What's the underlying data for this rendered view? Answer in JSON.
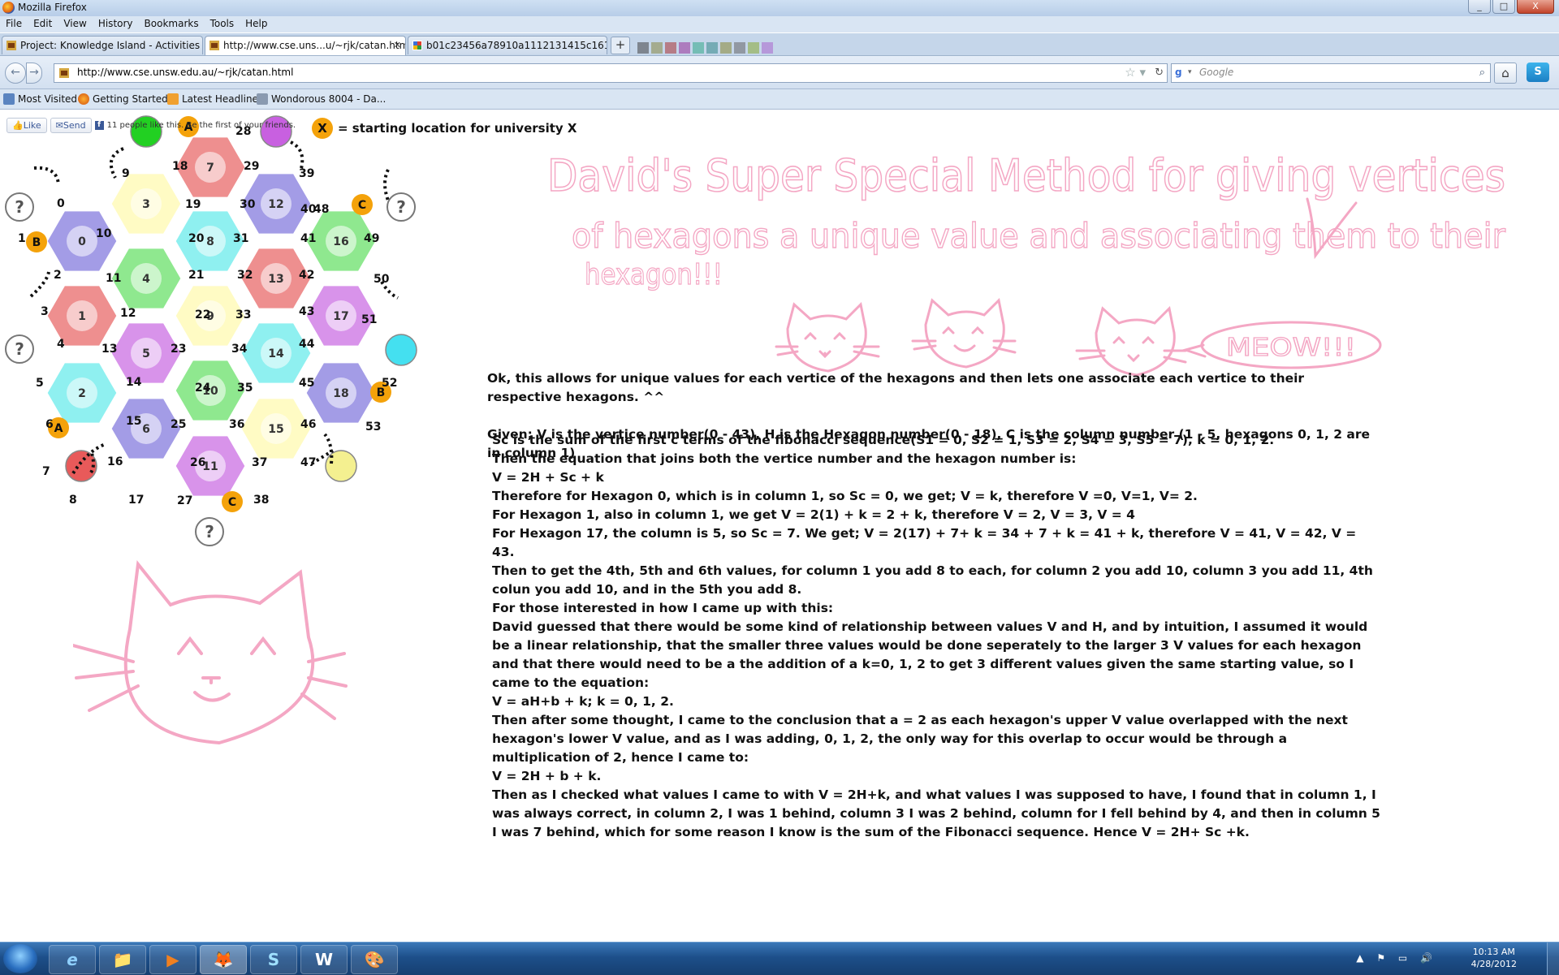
{
  "window": {
    "title": "Mozilla Firefox",
    "controls": [
      "_",
      "□",
      "X"
    ]
  },
  "menu": [
    "File",
    "Edit",
    "View",
    "History",
    "Bookmarks",
    "Tools",
    "Help"
  ],
  "tabs": [
    {
      "label": "Project: Knowledge Island - Activities ...",
      "active": false
    },
    {
      "label": "http://www.cse.uns...u/~rjk/catan.html",
      "active": true
    },
    {
      "label": "b01c23456a78910a1112131415c161...",
      "active": false
    }
  ],
  "newtab": "+",
  "nav": {
    "back": "←",
    "forward": "→",
    "url": "http://www.cse.unsw.edu.au/~rjk/catan.html",
    "search_placeholder": "Google",
    "search_engine": "g",
    "home": "⌂",
    "skype": "S"
  },
  "bookmarks": [
    "Most Visited",
    "Getting Started",
    "Latest Headlines",
    "Wondorous 8004 - Da..."
  ],
  "facebook": {
    "like": "Like",
    "send": "Send",
    "text": "11 people like this. Be the first of your friends."
  },
  "legend": {
    "badge": "X",
    "text": "= starting location for university X"
  },
  "board": {
    "hexes": [
      "0",
      "1",
      "2",
      "3",
      "4",
      "5",
      "6",
      "7",
      "8",
      "9",
      "10",
      "11",
      "12",
      "13",
      "14",
      "15",
      "16",
      "17",
      "18"
    ],
    "ports": [
      "?",
      "?",
      "?",
      "?"
    ],
    "markers": [
      "A",
      "B",
      "C",
      "A",
      "B",
      "C"
    ],
    "vertex_labels": [
      "0",
      "1",
      "2",
      "3",
      "4",
      "5",
      "6",
      "7",
      "8",
      "9",
      "10",
      "11",
      "12",
      "13",
      "14",
      "15",
      "16",
      "17",
      "18",
      "19",
      "20",
      "21",
      "22",
      "23",
      "24",
      "25",
      "26",
      "27",
      "28",
      "29",
      "30",
      "31",
      "32",
      "33",
      "34",
      "35",
      "36",
      "37",
      "38",
      "39",
      "40",
      "41",
      "42",
      "43",
      "44",
      "45",
      "46",
      "47",
      "48",
      "49",
      "50",
      "51",
      "52",
      "53"
    ]
  },
  "handwriting": {
    "title_line1": "David's Super Special Method for giving vertices",
    "title_line2": "of hexagons a unique value and associating them to their",
    "title_line3": "hexagon!!!",
    "meow": "MEOW!!!"
  },
  "content": {
    "intro": "Ok, this allows for unique values for each vertice of the hexagons and then lets one associate each vertice to their respective hexagons. ^^",
    "given": "Given; V is the vertice number(0 - 43), H is the Hexagon number(0 - 18), C is the column number (1 - 5, hexagons 0, 1, 2 are in column 1)",
    "lines": [
      "Sc is the sum of the first c terms of the fibonacci sequence(S1 = 0, S2 = 1, S3 = 2, S4 = 3, S5 = 7),  k = 0, 1, 2.",
      "Then the equation that joins both the vertice number and the hexagon number is:",
      "V = 2H + Sc + k",
      "Therefore for Hexagon 0, which is in column 1, so Sc = 0, we get; V = k, therefore V =0, V=1, V= 2.",
      "For Hexagon 1, also in column 1, we get V = 2(1) + k = 2 + k, therefore V = 2, V = 3, V = 4",
      "For Hexagon 17, the column is 5, so Sc = 7. We get; V = 2(17) + 7+ k = 34 + 7 + k = 41 + k, therefore V = 41, V = 42, V = 43.",
      "Then to get the 4th, 5th and 6th values, for column 1 you add 8 to each, for column 2 you add 10, column 3 you add 11, 4th colun you add 10, and in the 5th you add 8.",
      "For those interested in how I came up with this:",
      "David guessed that there would be some kind of relationship between values V and H, and by intuition, I assumed it would be a linear relationship, that the smaller three values would be done seperately to the larger 3 V values for each hexagon and that there would need to be a the addition of a k=0, 1, 2 to get 3 different values given the same starting value, so I came to the equation:",
      "V = aH+b + k; k = 0, 1, 2.",
      "Then after some thought, I came to the conclusion that a = 2 as each hexagon's upper V value overlapped with the next hexagon's lower V value, and as I was adding, 0, 1, 2, the only way for this overlap to occur would be through a multiplication of 2, hence I came to:",
      "V = 2H + b + k.",
      "Then as I checked what values I came to with V = 2H+k, and what values I was supposed to have, I found that in column 1, I was always correct, in column 2, I was 1 behind, column 3 I was 2 behind, column for I fell behind by 4, and then in column 5 I was 7 behind, which for some reason I know is the sum of the Fibonacci sequence. Hence V = 2H+ Sc +k."
    ]
  },
  "taskbar": {
    "time": "10:13 AM",
    "date": "4/28/2012",
    "apps": [
      "e",
      "📁",
      "▶",
      "🦊",
      "S",
      "W",
      "🎨"
    ]
  },
  "colors": {
    "hex_red": "#ee8f8f",
    "hex_yellow": "#fffbc4",
    "hex_purple": "#a39ce6",
    "hex_green": "#8fe88f",
    "hex_cyan": "#8ff0f0",
    "hex_violet": "#d893ea",
    "pink": "#f4a7c4",
    "marker": "#f4a20a"
  }
}
